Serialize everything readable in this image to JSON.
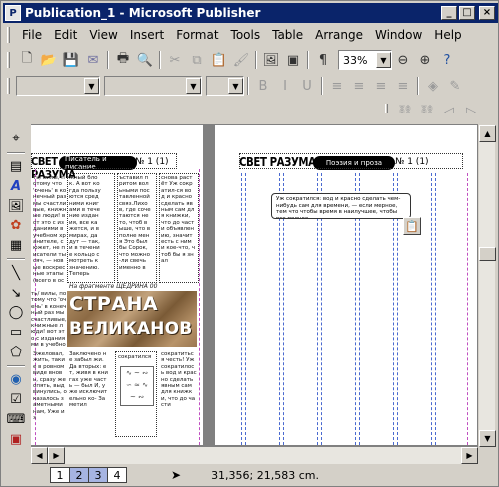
{
  "window": {
    "title": "Publication_1 - Microsoft Publisher",
    "buttons": {
      "minimize": "_",
      "maximize": "□",
      "close": "×"
    }
  },
  "menu": [
    "File",
    "Edit",
    "View",
    "Insert",
    "Format",
    "Tools",
    "Table",
    "Arrange",
    "Window",
    "Help"
  ],
  "standard_toolbar": {
    "zoom": "33%"
  },
  "format_toolbar": {
    "font_style": "",
    "font_name": "",
    "font_size": ""
  },
  "document": {
    "left_page": {
      "header_title": "СВЕТ РАЗУМА",
      "header_pill": "Писатель и писание",
      "page_no": "№ 1 (1)",
      "caption": "На фрагменте ЩЕДРИНА 00",
      "banner_line1": "СТРАНА",
      "banner_line2": "ВЕЛИКАНОВ",
      "col1_text": "ть/ вилы, потому что 'очень' в конечный раз мы счастливые, книжные люди! вот это с изданиями в учебном хранителе, сюжет, не писатели тысяч, — новые воскресные этапы (всего в основе трех тех идей!) тут нечего-что в карусели для бесконечности посредника подходящего, художественной поздравляемой",
      "col2_text": "жный блок. А вот когда пользуются средними книгами в течение издания, все кажется, и в мирах, дадут — так, и в течение кольцо смотреть к значению. Теперь",
      "col3_text": "ъставил притом вольными поставленной связ.Лихов, где сочетаются не то, чтоб выше, что вполне меня Это был бы Сорок, что можно-ли свечь именно в",
      "col4_text": "снова растёт Уж сократил-ся вод и красно сделать явным сам для книжки, что до части объявлению, значит есть с ними кое-что, чтоб бы я знал",
      "col1b_text": "Эжеловал, жить, такие в ровном виде вновь, сразу же опять, выдвинулись, оказалось заметными нам, Уже из",
      "col2b_text": "Заключено не забыл жи. Да вторых: ет, живя в книгах уже часть — был И, уже исключительно ко- Заметил",
      "col3b_text": "сократился",
      "col4b_text": "сократиться честь! Уж сократилось вод и красно сделать явным сам для книжки, что до части"
    },
    "right_page": {
      "header_title": "СВЕТ РАЗУМА",
      "header_pill": "Поэзия и проза",
      "page_no": "№ 1 (1)",
      "textbox": "Уж сократился: вод и красно сделать чем-нибудь сам для времени, — если мерное, тем что чтобы время в наилучшее, чтобы все полное"
    }
  },
  "status": {
    "pages": [
      "1",
      "2",
      "3",
      "4"
    ],
    "selected_pages": [
      "2",
      "3"
    ],
    "coords": "31,356; 21,583 cm."
  },
  "colors": {
    "title_bar": "#0a246a",
    "guide_blue": "#4a6ad0",
    "margin_magenta": "#c050c0",
    "page_selected": "#a6b4e2"
  }
}
